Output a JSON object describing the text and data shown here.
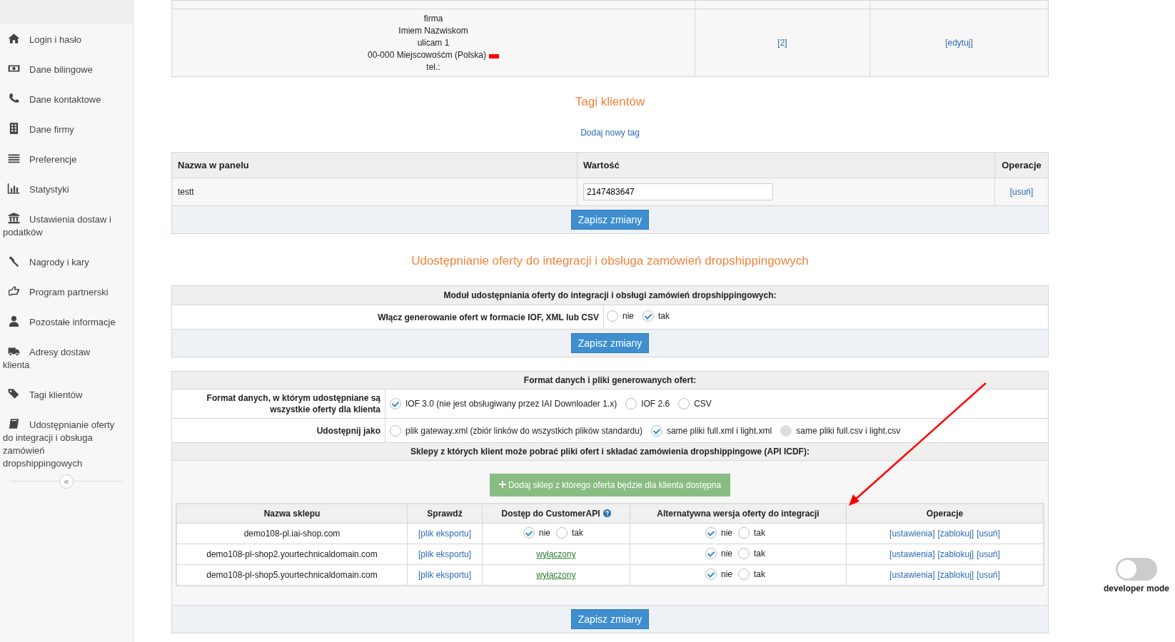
{
  "sidebar": {
    "items": [
      {
        "label": "Login i hasło"
      },
      {
        "label": "Dane bilingowe"
      },
      {
        "label": "Dane kontaktowe"
      },
      {
        "label": "Dane firmy"
      },
      {
        "label": "Preferencje"
      },
      {
        "label": "Statystyki"
      },
      {
        "label": "Ustawienia dostaw i podatków"
      },
      {
        "label": "Nagrody i kary"
      },
      {
        "label": "Program partnerski"
      },
      {
        "label": "Pozostałe informacje"
      },
      {
        "label": "Adresy dostaw klienta"
      },
      {
        "label": "Tagi klientów"
      },
      {
        "label": "Udostępnianie oferty do integracji i obsługa zamówień dropshippingowych"
      }
    ],
    "collapse": "«"
  },
  "addresses": {
    "rows": [
      {
        "lines": [],
        "count": "",
        "action": ""
      },
      {
        "lines": [
          "firma",
          "Imiem Nazwiskom",
          "ulicam 1",
          "00-000 Miejscowośćm (Polska)",
          "tel.:"
        ],
        "count": "[2]",
        "action": "[edytuj]"
      }
    ]
  },
  "tags": {
    "title": "Tagi klientów",
    "add_link": "Dodaj nowy tag",
    "columns": [
      "Nazwa w panelu",
      "Wartość",
      "Operacje"
    ],
    "rows": [
      {
        "name": "testt",
        "value": "2147483647",
        "action": "[usuń]"
      }
    ],
    "save": "Zapisz zmiany"
  },
  "sharing": {
    "title": "Udostępnianie oferty do integracji i obsługa zamówień dropshippingowych",
    "module": {
      "heading": "Moduł udostępniania oferty do integracji i obsługi zamówień dropshippingowych:",
      "label": "Włącz generowanie ofert w formacie IOF, XML lub CSV",
      "options": [
        {
          "label": "nie",
          "selected": false,
          "disabled": false
        },
        {
          "label": "tak",
          "selected": true,
          "disabled": false
        }
      ],
      "save": "Zapisz zmiany"
    },
    "format": {
      "heading": "Format danych i pliki generowanych ofert:",
      "fields": [
        {
          "label": "Format danych, w którym udostępniane są wszystkie oferty dla klienta",
          "options": [
            {
              "label": "IOF 3.0 (nie jest obsługiwany przez IAI Downloader 1.x)",
              "selected": true,
              "disabled": false
            },
            {
              "label": "IOF 2.6",
              "selected": false,
              "disabled": false
            },
            {
              "label": "CSV",
              "selected": false,
              "disabled": false
            }
          ]
        },
        {
          "label": "Udostępnij jako",
          "options": [
            {
              "label": "plik gateway.xml (zbiór linków do wszystkich plików standardu)",
              "selected": false,
              "disabled": false
            },
            {
              "label": "same pliki full.xml i light.xml",
              "selected": true,
              "disabled": false
            },
            {
              "label": "same pliki full.csv i light.csv",
              "selected": false,
              "disabled": true
            }
          ]
        }
      ],
      "shops_heading": "Sklepy z których klient może pobrać pliki ofert i składać zamówienia dropshippingowe (API ICDF):",
      "add_shop": "Dodaj sklep z którego oferta będzie dla klienta dostępna",
      "columns": [
        "Nazwa sklepu",
        "Sprawdź",
        "Dostęp do CustomerAPI",
        "Alternatywna wersja oferty do integracji",
        "Operacje"
      ],
      "shops": [
        {
          "name": "demo108-pl.iai-shop.com",
          "check": "[plik eksportu]",
          "api": {
            "kind": "radio",
            "options": [
              {
                "label": "nie",
                "selected": true,
                "disabled": false
              },
              {
                "label": "tak",
                "selected": false,
                "disabled": false
              }
            ]
          },
          "alt": [
            {
              "label": "nie",
              "selected": true,
              "disabled": false
            },
            {
              "label": "tak",
              "selected": false,
              "disabled": false
            }
          ],
          "ops": [
            "[ustawienia]",
            "[zablokuj]",
            "[usuń]"
          ]
        },
        {
          "name": "demo108-pl-shop2.yourtechnicaldomain.com",
          "check": "[plik eksportu]",
          "api": {
            "kind": "link",
            "text": "wyłączony"
          },
          "alt": [
            {
              "label": "nie",
              "selected": true,
              "disabled": false
            },
            {
              "label": "tak",
              "selected": false,
              "disabled": false
            }
          ],
          "ops": [
            "[ustawienia]",
            "[zablokuj]",
            "[usuń]"
          ]
        },
        {
          "name": "demo108-pl-shop5.yourtechnicaldomain.com",
          "check": "[plik eksportu]",
          "api": {
            "kind": "link",
            "text": "wyłączony"
          },
          "alt": [
            {
              "label": "nie",
              "selected": true,
              "disabled": false
            },
            {
              "label": "tak",
              "selected": false,
              "disabled": false
            }
          ],
          "ops": [
            "[ustawienia]",
            "[zablokuj]",
            "[usuń]"
          ]
        }
      ],
      "save": "Zapisz zmiany"
    }
  },
  "developer_mode": {
    "label": "developer mode",
    "on": false
  }
}
